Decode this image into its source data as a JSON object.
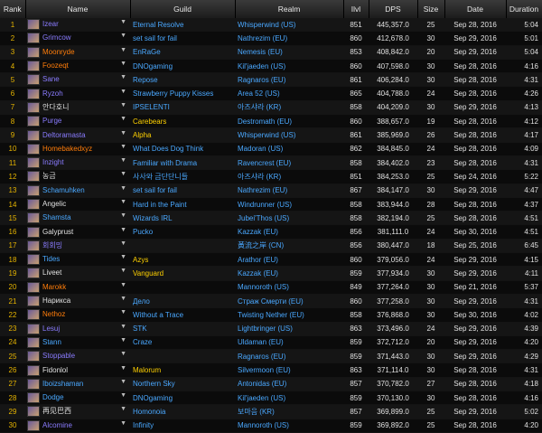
{
  "headers": [
    "Rank",
    "Name",
    "Guild",
    "Realm",
    "Ilvl",
    "DPS",
    "Size",
    "Date",
    "Duration"
  ],
  "rows": [
    {
      "rank": "1",
      "name": "Izear",
      "name_color": "#8a7cff",
      "guild": "Eternal Resolve",
      "guild_color": "#4aa8ff",
      "realm": "Whisperwind (US)",
      "ilvl": "851",
      "dps": "445,357.0",
      "size": "25",
      "date": "Sep 28, 2016",
      "duration": "5:04"
    },
    {
      "rank": "2",
      "name": "Grimcow",
      "name_color": "#8a7cff",
      "guild": "set sail for fail",
      "guild_color": "#4aa8ff",
      "realm": "Nathrezim (EU)",
      "ilvl": "860",
      "dps": "412,678.0",
      "size": "30",
      "date": "Sep 29, 2016",
      "duration": "5:01"
    },
    {
      "rank": "3",
      "name": "Moonryde",
      "name_color": "#ff7d0a",
      "guild": "EnRaGe",
      "guild_color": "#4aa8ff",
      "realm": "Nemesis (EU)",
      "ilvl": "853",
      "dps": "408,842.0",
      "size": "20",
      "date": "Sep 29, 2016",
      "duration": "5:04"
    },
    {
      "rank": "4",
      "name": "Foozeqt",
      "name_color": "#ff7d0a",
      "guild": "DNOgaming",
      "guild_color": "#4aa8ff",
      "realm": "Kil'jaeden (US)",
      "ilvl": "860",
      "dps": "407,598.0",
      "size": "30",
      "date": "Sep 28, 2016",
      "duration": "4:16"
    },
    {
      "rank": "5",
      "name": "Sane",
      "name_color": "#8a7cff",
      "guild": "Repose",
      "guild_color": "#4aa8ff",
      "realm": "Ragnaros (EU)",
      "ilvl": "861",
      "dps": "406,284.0",
      "size": "30",
      "date": "Sep 28, 2016",
      "duration": "4:31"
    },
    {
      "rank": "6",
      "name": "Ryzoh",
      "name_color": "#8a7cff",
      "guild": "Strawberry Puppy Kisses",
      "guild_color": "#4aa8ff",
      "realm": "Area 52 (US)",
      "ilvl": "865",
      "dps": "404,788.0",
      "size": "24",
      "date": "Sep 28, 2016",
      "duration": "4:26"
    },
    {
      "rank": "7",
      "name": "안다호니",
      "name_color": "#e0e0e0",
      "guild": "IPSELENTI",
      "guild_color": "#4aa8ff",
      "realm": "아즈샤라 (KR)",
      "ilvl": "858",
      "dps": "404,209.0",
      "size": "30",
      "date": "Sep 29, 2016",
      "duration": "4:13"
    },
    {
      "rank": "8",
      "name": "Purge",
      "name_color": "#8a7cff",
      "guild": "Carebears",
      "guild_color": "#ffd100",
      "realm": "Destromath (EU)",
      "ilvl": "860",
      "dps": "388,657.0",
      "size": "19",
      "date": "Sep 28, 2016",
      "duration": "4:12"
    },
    {
      "rank": "9",
      "name": "Deltoramasta",
      "name_color": "#8a7cff",
      "guild": "Alpha",
      "guild_color": "#ffd100",
      "realm": "Whisperwind (US)",
      "ilvl": "861",
      "dps": "385,969.0",
      "size": "26",
      "date": "Sep 28, 2016",
      "duration": "4:17"
    },
    {
      "rank": "10",
      "name": "Homebakedxyz",
      "name_color": "#ff7d0a",
      "guild": "What Does Dog Think",
      "guild_color": "#4aa8ff",
      "realm": "Madoran (US)",
      "ilvl": "862",
      "dps": "384,845.0",
      "size": "24",
      "date": "Sep 28, 2016",
      "duration": "4:09"
    },
    {
      "rank": "11",
      "name": "Inzight",
      "name_color": "#8a7cff",
      "guild": "Familiar with Drama",
      "guild_color": "#4aa8ff",
      "realm": "Ravencrest (EU)",
      "ilvl": "858",
      "dps": "384,402.0",
      "size": "23",
      "date": "Sep 28, 2016",
      "duration": "4:31"
    },
    {
      "rank": "12",
      "name": "농금",
      "name_color": "#e0e0e0",
      "guild": "사사와 금단단니들",
      "guild_color": "#4aa8ff",
      "realm": "아즈샤라 (KR)",
      "ilvl": "851",
      "dps": "384,253.0",
      "size": "25",
      "date": "Sep 24, 2016",
      "duration": "5:22"
    },
    {
      "rank": "13",
      "name": "Schamuhken",
      "name_color": "#4aa8ff",
      "guild": "set sail for fail",
      "guild_color": "#4aa8ff",
      "realm": "Nathrezim (EU)",
      "ilvl": "867",
      "dps": "384,147.0",
      "size": "30",
      "date": "Sep 29, 2016",
      "duration": "4:47"
    },
    {
      "rank": "14",
      "name": "Angelic",
      "name_color": "#e0e0e0",
      "guild": "Hard in the Paint",
      "guild_color": "#4aa8ff",
      "realm": "Windrunner (US)",
      "ilvl": "858",
      "dps": "383,944.0",
      "size": "28",
      "date": "Sep 28, 2016",
      "duration": "4:37"
    },
    {
      "rank": "15",
      "name": "Shamsta",
      "name_color": "#4aa8ff",
      "guild": "Wizards IRL",
      "guild_color": "#4aa8ff",
      "realm": "Jubei'Thos (US)",
      "ilvl": "858",
      "dps": "382,194.0",
      "size": "25",
      "date": "Sep 28, 2016",
      "duration": "4:51"
    },
    {
      "rank": "16",
      "name": "Galyprust",
      "name_color": "#e0e0e0",
      "guild": "Pucko",
      "guild_color": "#4aa8ff",
      "realm": "Kazzak (EU)",
      "ilvl": "856",
      "dps": "381,111.0",
      "size": "24",
      "date": "Sep 30, 2016",
      "duration": "4:51"
    },
    {
      "rank": "17",
      "name": "회회밍",
      "name_color": "#8a7cff",
      "guild": "",
      "guild_color": "#4aa8ff",
      "realm": "黃流之岸 (CN)",
      "ilvl": "856",
      "dps": "380,447.0",
      "size": "18",
      "date": "Sep 25, 2016",
      "duration": "6:45"
    },
    {
      "rank": "18",
      "name": "Tides",
      "name_color": "#4aa8ff",
      "guild": "Azys",
      "guild_color": "#ffd100",
      "realm": "Arathor (EU)",
      "ilvl": "860",
      "dps": "379,056.0",
      "size": "24",
      "date": "Sep 29, 2016",
      "duration": "4:15"
    },
    {
      "rank": "19",
      "name": "Liveet",
      "name_color": "#e0e0e0",
      "guild": "Vanguard",
      "guild_color": "#ffd100",
      "realm": "Kazzak (EU)",
      "ilvl": "859",
      "dps": "377,934.0",
      "size": "30",
      "date": "Sep 29, 2016",
      "duration": "4:11"
    },
    {
      "rank": "20",
      "name": "Marokk",
      "name_color": "#ff7d0a",
      "guild": "",
      "guild_color": "#4aa8ff",
      "realm": "Mannoroth (US)",
      "ilvl": "849",
      "dps": "377,264.0",
      "size": "30",
      "date": "Sep 21, 2016",
      "duration": "5:37"
    },
    {
      "rank": "21",
      "name": "Нарикса",
      "name_color": "#e0e0e0",
      "guild": "Дело",
      "guild_color": "#4aa8ff",
      "realm": "Страж Смерти (EU)",
      "ilvl": "860",
      "dps": "377,258.0",
      "size": "30",
      "date": "Sep 29, 2016",
      "duration": "4:31"
    },
    {
      "rank": "22",
      "name": "Nethoz",
      "name_color": "#ff7d0a",
      "guild": "Without a Trace",
      "guild_color": "#4aa8ff",
      "realm": "Twisting Nether (EU)",
      "ilvl": "858",
      "dps": "376,868.0",
      "size": "30",
      "date": "Sep 30, 2016",
      "duration": "4:02"
    },
    {
      "rank": "23",
      "name": "Lesuj",
      "name_color": "#8a7cff",
      "guild": "STK",
      "guild_color": "#4aa8ff",
      "realm": "Lightbringer (US)",
      "ilvl": "863",
      "dps": "373,496.0",
      "size": "24",
      "date": "Sep 29, 2016",
      "duration": "4:39"
    },
    {
      "rank": "24",
      "name": "Stann",
      "name_color": "#4aa8ff",
      "guild": "Craze",
      "guild_color": "#4aa8ff",
      "realm": "Uldaman (EU)",
      "ilvl": "859",
      "dps": "372,712.0",
      "size": "20",
      "date": "Sep 29, 2016",
      "duration": "4:20"
    },
    {
      "rank": "25",
      "name": "Stoppable",
      "name_color": "#8a7cff",
      "guild": "",
      "guild_color": "#4aa8ff",
      "realm": "Ragnaros (EU)",
      "ilvl": "859",
      "dps": "371,443.0",
      "size": "30",
      "date": "Sep 29, 2016",
      "duration": "4:29"
    },
    {
      "rank": "26",
      "name": "Fidonlol",
      "name_color": "#e0e0e0",
      "guild": "Malorum",
      "guild_color": "#ffd100",
      "realm": "Silvermoon (EU)",
      "ilvl": "863",
      "dps": "371,114.0",
      "size": "30",
      "date": "Sep 28, 2016",
      "duration": "4:31"
    },
    {
      "rank": "27",
      "name": "Iboizshaman",
      "name_color": "#4aa8ff",
      "guild": "Northern Sky",
      "guild_color": "#4aa8ff",
      "realm": "Antonidas (EU)",
      "ilvl": "857",
      "dps": "370,782.0",
      "size": "27",
      "date": "Sep 28, 2016",
      "duration": "4:18"
    },
    {
      "rank": "28",
      "name": "Dodge",
      "name_color": "#4aa8ff",
      "guild": "DNOgaming",
      "guild_color": "#4aa8ff",
      "realm": "Kil'jaeden (US)",
      "ilvl": "859",
      "dps": "370,130.0",
      "size": "30",
      "date": "Sep 28, 2016",
      "duration": "4:16"
    },
    {
      "rank": "29",
      "name": "再见巴西",
      "name_color": "#e0e0e0",
      "guild": "Homonoia",
      "guild_color": "#4aa8ff",
      "realm": "보마음 (KR)",
      "ilvl": "857",
      "dps": "369,899.0",
      "size": "25",
      "date": "Sep 29, 2016",
      "duration": "5:02"
    },
    {
      "rank": "30",
      "name": "Alcomine",
      "name_color": "#8a7cff",
      "guild": "Infinity",
      "guild_color": "#4aa8ff",
      "realm": "Mannoroth (US)",
      "ilvl": "859",
      "dps": "369,892.0",
      "size": "25",
      "date": "Sep 28, 2016",
      "duration": "4:20"
    }
  ]
}
